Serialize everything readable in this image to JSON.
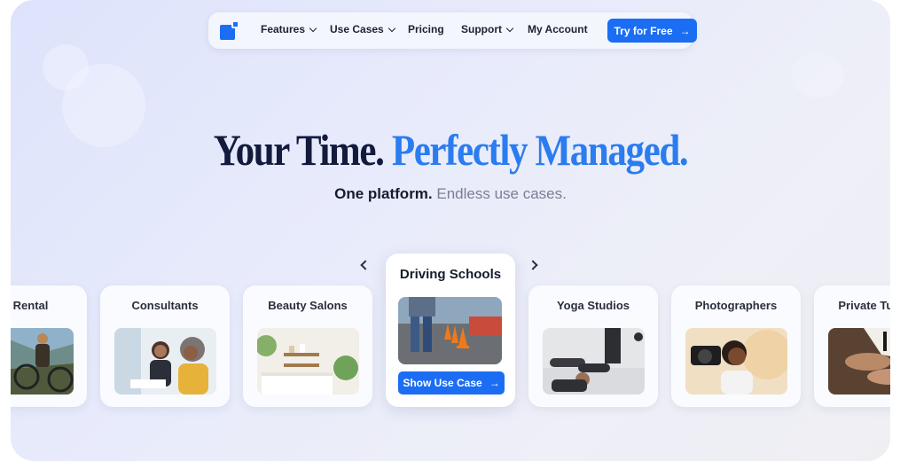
{
  "nav": {
    "logo_icon": "logo-icon",
    "items": [
      {
        "label": "Features",
        "has_dropdown": true
      },
      {
        "label": "Use Cases",
        "has_dropdown": true
      },
      {
        "label": "Pricing",
        "has_dropdown": false
      },
      {
        "label": "Support",
        "has_dropdown": true
      },
      {
        "label": "My Account",
        "has_dropdown": false
      }
    ],
    "cta_label": "Try for Free",
    "cta_icon": "arrow-right-icon"
  },
  "hero": {
    "title_part1": "Your Time.",
    "title_part2": "Perfectly Managed.",
    "subtitle_part1": "One platform.",
    "subtitle_part2": "Endless use cases."
  },
  "carousel": {
    "prev_icon": "chevron-left-icon",
    "next_icon": "chevron-right-icon",
    "cards": [
      {
        "label": "Bike Rental",
        "image": "mountain-bikers-photo"
      },
      {
        "label": "Consultants",
        "image": "consultants-meeting-photo"
      },
      {
        "label": "Beauty Salons",
        "image": "salon-interior-photo"
      },
      {
        "label": "Driving Schools",
        "image": "traffic-cones-photo",
        "active": true,
        "button_label": "Show Use Case"
      },
      {
        "label": "Yoga Studios",
        "image": "yoga-class-photo"
      },
      {
        "label": "Photographers",
        "image": "photographer-camera-photo"
      },
      {
        "label": "Private Tutor",
        "image": "piano-lesson-photo"
      }
    ]
  },
  "colors": {
    "accent": "#1b6ef3",
    "title_dark": "#121a3d",
    "title_blue": "#2b7cf0",
    "subtitle_gray": "#7a7f92"
  }
}
